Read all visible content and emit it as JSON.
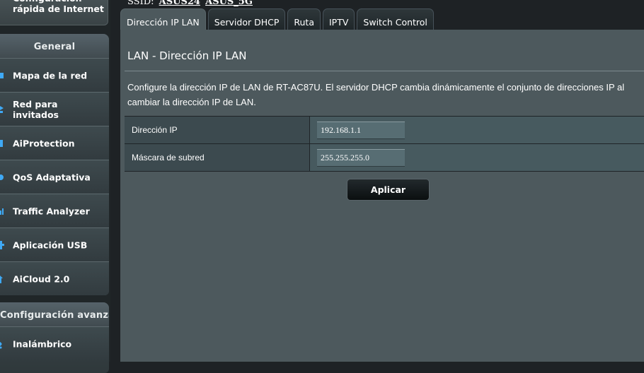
{
  "sidebar": {
    "quick_setup": "Configuración\nrápida de Internet",
    "general": {
      "header": "General",
      "items": [
        {
          "label": "Mapa de la red",
          "icon": "network-map-icon"
        },
        {
          "label": "Red para\ninvitados",
          "icon": "guest-network-icon"
        },
        {
          "label": "AiProtection",
          "icon": "aiprotection-icon"
        },
        {
          "label": "QoS Adaptativa",
          "icon": "qos-icon"
        },
        {
          "label": "Traffic Analyzer",
          "icon": "traffic-analyzer-icon"
        },
        {
          "label": "Aplicación USB",
          "icon": "usb-icon"
        },
        {
          "label": "AiCloud 2.0",
          "icon": "aicloud-icon"
        }
      ]
    },
    "advanced": {
      "header": "Configuración avanzada",
      "items": [
        {
          "label": "Inalámbrico",
          "icon": "wireless-icon"
        }
      ]
    }
  },
  "ssid": {
    "prefix": "SSID:",
    "networks": [
      "ASUS24",
      "ASUS_5G"
    ]
  },
  "tabs": [
    {
      "label": "Dirección IP LAN",
      "active": true
    },
    {
      "label": "Servidor DHCP",
      "active": false
    },
    {
      "label": "Ruta",
      "active": false
    },
    {
      "label": "IPTV",
      "active": false
    },
    {
      "label": "Switch Control",
      "active": false
    }
  ],
  "main": {
    "title": "LAN - Dirección IP LAN",
    "description": "Configure la dirección IP de LAN de RT-AC87U. El servidor DHCP cambia dinámicamente el conjunto de direcciones IP al cambiar la dirección IP de LAN.",
    "fields": [
      {
        "label": "Dirección IP",
        "value": "192.168.1.1"
      },
      {
        "label": "Máscara de subred",
        "value": "255.255.255.0"
      }
    ],
    "apply_label": "Aplicar"
  },
  "colors": {
    "content_bg": "#4d595d",
    "icon_accent": "#3fa9f5"
  }
}
